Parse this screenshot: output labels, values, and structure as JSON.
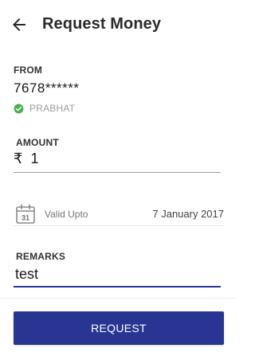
{
  "header": {
    "title": "Request Money",
    "back_icon": "arrow-left-icon"
  },
  "from": {
    "label": "FROM",
    "account": "7678******",
    "verified_name": "PRABHAT",
    "verified_icon": "check-circle-icon",
    "verified_color": "#4caf50"
  },
  "amount": {
    "label": "AMOUNT",
    "currency": "₹",
    "value": "1"
  },
  "validity": {
    "icon": "calendar-icon",
    "calendar_day": "31",
    "label": "Valid Upto",
    "date": "7 January 2017"
  },
  "remarks": {
    "label": "REMARKS",
    "value": "test"
  },
  "actions": {
    "request_label": "REQUEST"
  },
  "colors": {
    "primary": "#283593",
    "text": "#212121",
    "muted": "#9e9e9e"
  }
}
